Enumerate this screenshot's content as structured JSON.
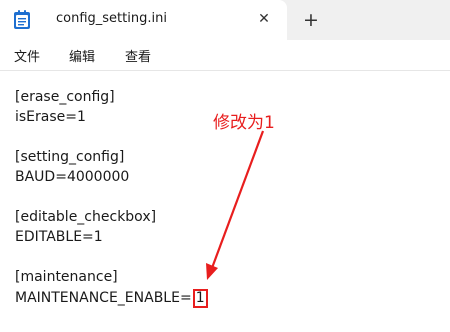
{
  "tab": {
    "title": "config_setting.ini",
    "close_icon": "close-icon",
    "new_tab_icon": "plus-icon"
  },
  "menu": {
    "file": "文件",
    "edit": "编辑",
    "view": "查看"
  },
  "editor": {
    "lines": [
      "[erase_config]",
      "isErase=1",
      "",
      "[setting_config]",
      "BAUD=4000000",
      "",
      "[editable_checkbox]",
      "EDITABLE=1",
      "",
      "[maintenance]",
      "MAINTENANCE_ENABLE="
    ],
    "highlighted_value": "1"
  },
  "annotation": {
    "text": "修改为1",
    "color": "#e81e1e"
  },
  "colors": {
    "accent_red": "#e81e1e",
    "notepad_icon": "#0f6cbd"
  }
}
